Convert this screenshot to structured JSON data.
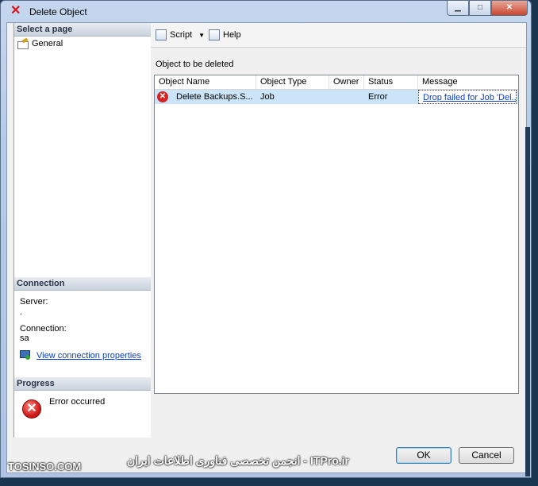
{
  "window": {
    "title": "Delete Object",
    "title_icon": "red-x-icon",
    "controls": [
      "minimize",
      "maximize",
      "close"
    ]
  },
  "left_pane": {
    "select_page_header": "Select a page",
    "pages": [
      {
        "label": "General",
        "icon": "general-page-icon"
      }
    ],
    "connection_header": "Connection",
    "server_label": "Server:",
    "server_value": ".",
    "connection_label": "Connection:",
    "connection_value": "sa",
    "view_connection_link": "View connection properties",
    "progress_header": "Progress",
    "progress_status": "Error occurred"
  },
  "toolbar": {
    "script_label": "Script",
    "help_label": "Help"
  },
  "main": {
    "object_label": "Object to be deleted",
    "columns": [
      "Object Name",
      "Object Type",
      "Owner",
      "Status",
      "Message"
    ],
    "rows": [
      {
        "object_name": "Delete Backups.S...",
        "object_type": "Job",
        "owner": "",
        "status": "Error",
        "message": "Drop failed for Job 'Del..."
      }
    ]
  },
  "buttons": {
    "ok": "OK",
    "cancel": "Cancel"
  },
  "watermark": {
    "left": "TOSINSO.COM",
    "center": "ITPro.ir - انجمن تخصصی فناوری اطلاعات ایران"
  },
  "colors": {
    "error_red": "#d32323",
    "selection_blue": "#cce4f7",
    "link_blue": "#0b3ec9"
  }
}
